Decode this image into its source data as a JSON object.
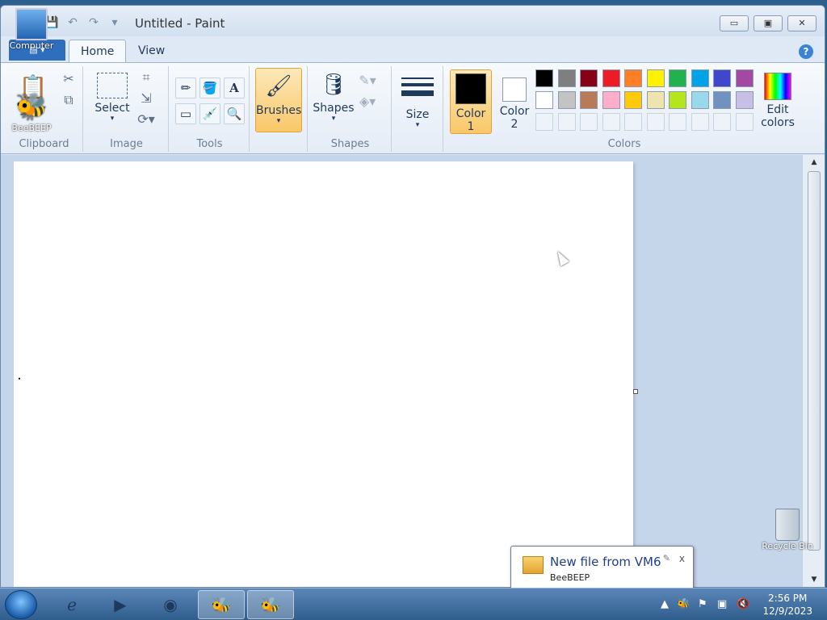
{
  "window": {
    "title": "Untitled - Paint",
    "minimize": "▭",
    "maximize": "▣",
    "close": "✕"
  },
  "tabs": {
    "file": "▤ ▾",
    "home": "Home",
    "view": "View",
    "help": "?"
  },
  "ribbon": {
    "clipboard_label": "Clipboard",
    "image_label": "Image",
    "select": "Select",
    "tools_label": "Tools",
    "brushes": "Brushes",
    "shapes": "Shapes",
    "shapes_label": "Shapes",
    "size": "Size",
    "color1": "Color\n1",
    "color1_a": "Color",
    "color1_b": "1",
    "color2_a": "Color",
    "color2_b": "2",
    "colors_label": "Colors",
    "edit_colors_a": "Edit",
    "edit_colors_b": "colors"
  },
  "palette_row1": [
    "#000000",
    "#7f7f7f",
    "#880015",
    "#ed1c24",
    "#ff7f27",
    "#fff200",
    "#22b14c",
    "#00a2e8",
    "#3f48cc",
    "#a349a4"
  ],
  "palette_row2": [
    "#ffffff",
    "#c3c3c3",
    "#b97a57",
    "#ffaec9",
    "#ffc90e",
    "#efe4b0",
    "#b5e61d",
    "#99d9ea",
    "#7092be",
    "#c8bfe7"
  ],
  "desktop": {
    "computer": "Computer",
    "beebeep": "BeeBEEP",
    "recycle_bin": "Recycle Bin"
  },
  "notification": {
    "title": "New file from VM6",
    "subtitle": "BeeBEEP",
    "close": "x"
  },
  "taskbar": {
    "time": "2:56 PM",
    "date": "12/9/2023"
  }
}
